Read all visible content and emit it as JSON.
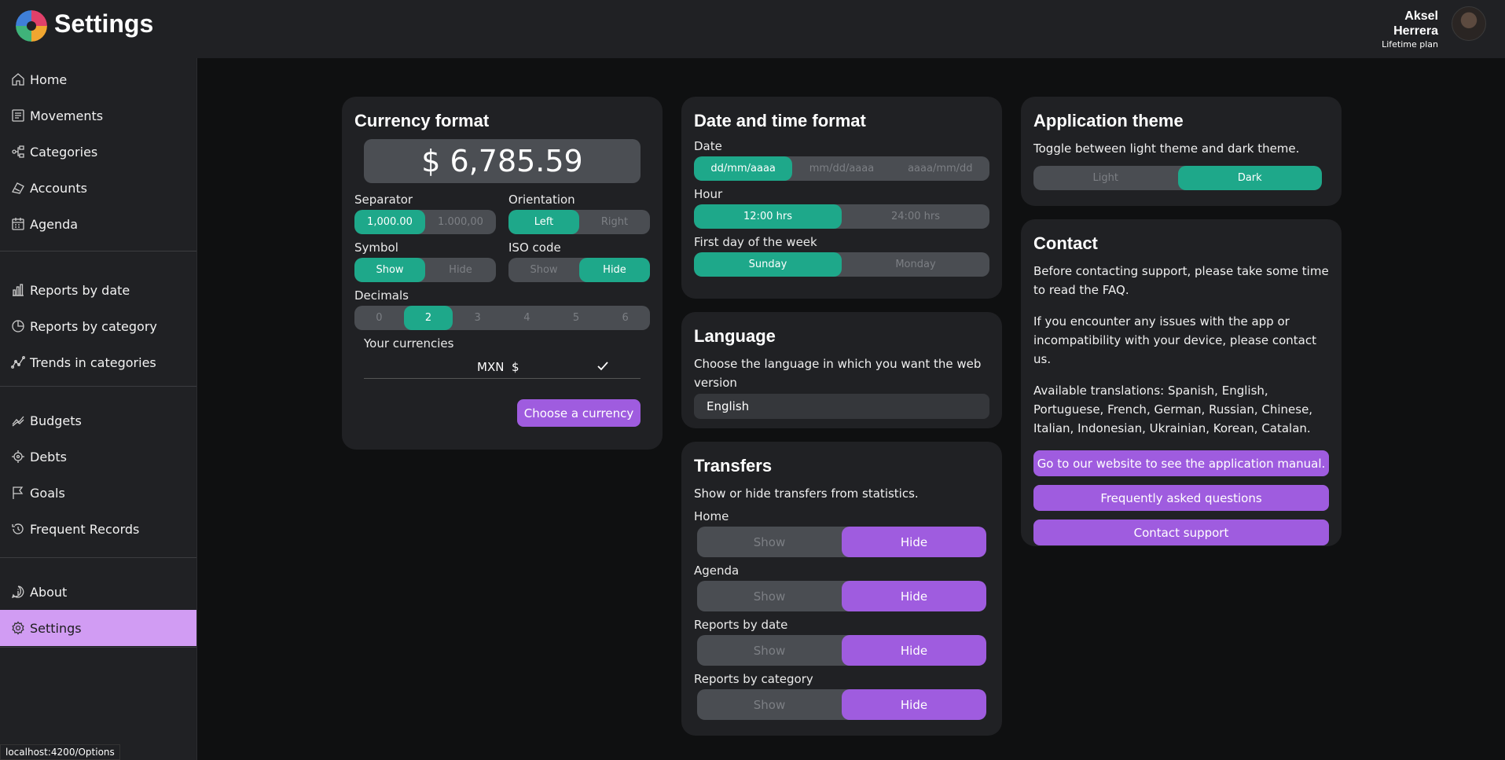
{
  "app": {
    "title": "Settings"
  },
  "user": {
    "first_name": "Aksel",
    "last_name": "Herrera",
    "plan": "Lifetime plan"
  },
  "sidebar": {
    "items": [
      {
        "label": "Home",
        "icon": "home-icon"
      },
      {
        "label": "Movements",
        "icon": "receipt-icon"
      },
      {
        "label": "Categories",
        "icon": "categories-icon"
      },
      {
        "label": "Accounts",
        "icon": "accounts-icon"
      },
      {
        "label": "Agenda",
        "icon": "calendar-icon"
      },
      {
        "label": "Reports by date",
        "icon": "bar-chart-icon"
      },
      {
        "label": "Reports by category",
        "icon": "pie-chart-icon"
      },
      {
        "label": "Trends in categories",
        "icon": "trend-icon"
      },
      {
        "label": "Budgets",
        "icon": "budget-icon"
      },
      {
        "label": "Debts",
        "icon": "debt-icon"
      },
      {
        "label": "Goals",
        "icon": "flag-icon"
      },
      {
        "label": "Frequent Records",
        "icon": "history-icon"
      },
      {
        "label": "About",
        "icon": "info-icon"
      },
      {
        "label": "Settings",
        "icon": "gear-icon"
      }
    ],
    "active": "Settings"
  },
  "status_url": "localhost:4200/Options",
  "currency": {
    "title": "Currency format",
    "amount": "$ 6,785.59",
    "separator": {
      "label": "Separator",
      "options": [
        "1,000.00",
        "1.000,00"
      ],
      "selected": "1,000.00"
    },
    "orientation": {
      "label": "Orientation",
      "options": [
        "Left",
        "Right"
      ],
      "selected": "Left"
    },
    "symbol": {
      "label": "Symbol",
      "options": [
        "Show",
        "Hide"
      ],
      "selected": "Show"
    },
    "iso": {
      "label": "ISO code",
      "options": [
        "Show",
        "Hide"
      ],
      "selected": "Hide"
    },
    "decimals": {
      "label": "Decimals",
      "options": [
        "0",
        "2",
        "3",
        "4",
        "5",
        "6"
      ],
      "selected": "2"
    },
    "your_currencies_label": "Your currencies",
    "currency_code": "MXN",
    "currency_symbol": "$",
    "choose_button": "Choose a currency"
  },
  "datetime": {
    "title": "Date and time format",
    "date": {
      "label": "Date",
      "options": [
        "dd/mm/aaaa",
        "mm/dd/aaaa",
        "aaaa/mm/dd"
      ],
      "selected": "dd/mm/aaaa"
    },
    "hour": {
      "label": "Hour",
      "options": [
        "12:00 hrs",
        "24:00 hrs"
      ],
      "selected": "12:00 hrs"
    },
    "first_day": {
      "label": "First day of the week",
      "options": [
        "Sunday",
        "Monday"
      ],
      "selected": "Sunday"
    }
  },
  "language": {
    "title": "Language",
    "description": "Choose the language in which you want the web version",
    "value": "English"
  },
  "transfers": {
    "title": "Transfers",
    "description": "Show or hide transfers from statistics.",
    "rows": [
      {
        "label": "Home",
        "options": [
          "Show",
          "Hide"
        ],
        "selected": "Hide"
      },
      {
        "label": "Agenda",
        "options": [
          "Show",
          "Hide"
        ],
        "selected": "Hide"
      },
      {
        "label": "Reports by date",
        "options": [
          "Show",
          "Hide"
        ],
        "selected": "Hide"
      },
      {
        "label": "Reports by category",
        "options": [
          "Show",
          "Hide"
        ],
        "selected": "Hide"
      }
    ]
  },
  "theme": {
    "title": "Application theme",
    "description": "Toggle between light theme and dark theme.",
    "options": [
      "Light",
      "Dark"
    ],
    "selected": "Dark"
  },
  "contact": {
    "title": "Contact",
    "p1": "Before contacting support, please take some time to read the FAQ.",
    "p2": "If you encounter any issues with the app or incompatibility with your device, please contact us.",
    "p3": "Available translations: Spanish, English, Portuguese, French, German, Russian, Chinese, Italian, Indonesian, Ukrainian, Korean, Catalan.",
    "buttons": [
      "Go to our website to see the application manual.",
      "Frequently asked questions",
      "Contact support"
    ]
  },
  "colors": {
    "green": "#1ea88a",
    "purple": "#9f5cdf",
    "active_nav": "#d19cf3",
    "panel": "#202124",
    "background": "#0f1011"
  }
}
